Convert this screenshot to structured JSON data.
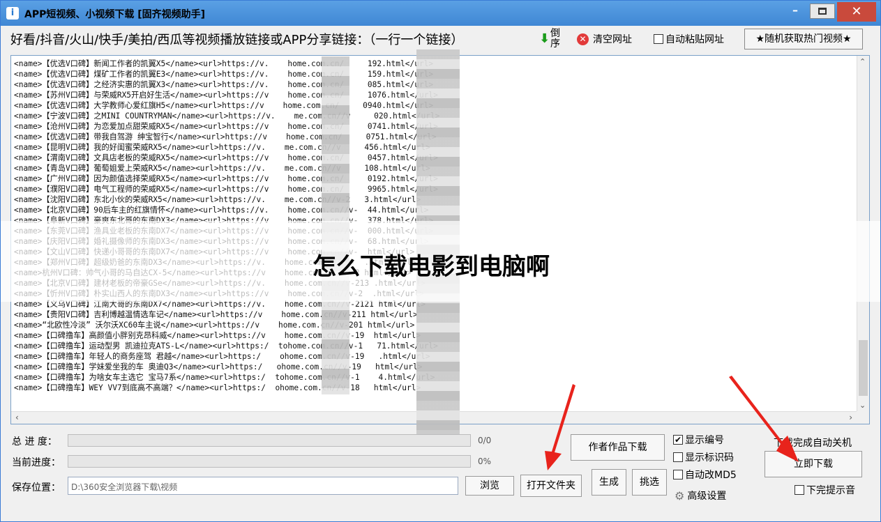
{
  "window": {
    "title": "APP短视频、小视频下载 [固齐视频助手]",
    "minimize_glyph": "–",
    "close_glyph": "✕"
  },
  "toolbar": {
    "instruction": "好看/抖音/火山/快手/美拍/西瓜等视频播放链接或APP分享链接：（一行一个链接）",
    "sort_arrow": "⬇",
    "sort_label": "倒序",
    "clear_icon_glyph": "✕",
    "clear_label": "清空网址",
    "auto_paste_label": "自动粘贴网址",
    "auto_paste_checked": false,
    "random_hot_label": "★随机获取热门视频★"
  },
  "links": [
    "<name>【优选V口碑】新闻工作者的凯翼X5</name><url>https://v.    home.com.cn/     192.html</url>",
    "<name>【优选V口碑】煤矿工作者的凯翼E3</name><url>https://v.    home.com.cn/     159.html</url>",
    "<name>【优选V口碑】之经济实惠的凯翼X3</name><url>https://v.    home.com.cn/     085.html</url>",
    "<name>【苏州V口碑】与荣威RX5开启好生活</name><url>https://v    home.com.cn/     1076.html</url>",
    "<name>【优选V口碑】大学教师心爱红旗H5</name><url>https://v    home.com.cn/     0940.html</url>",
    "<name>【宁波V口碑】之MINI COUNTRYMAN</name><url>https://v.    me.com.cn//v     020.html</url>",
    "<name>【沧州V口碑】为恋爱加点甜荣威RX5</name><url>https://v    home.com.cn/     0741.html</url>",
    "<name>【优选V口碑】带我自驾游 绅宝智行</name><url>https://v    home.com.cn/     0751.html</url>",
    "<name>【昆明V口碑】我的好闺蜜荣威RX5</name><url>https://v.    me.com.cn//v     456.html</url>",
    "<name>【渭南V口碑】文具店老板的荣威RX5</name><url>https://v    home.com.cn/     0457.html</url>",
    "<name>【青岛V口碑】葡萄姐爱上荣威RX5</name><url>https://v.    me.com.cn//v     108.html</url>",
    "<name>【广州V口碑】因为颜值选择荣威RX5</name><url>https://v    home.com.cn/     0192.html</url>",
    "<name>【濮阳V口碑】电气工程师的荣威RX5</name><url>https://v    home.com.cn/     9965.html</url>",
    "<name>【沈阳V口碑】东北小伙的荣威RX5</name><url>https://v.    me.com.cn//v-2   3.html</url>",
    "<name>【北京V口碑】90后车主的红旗情怀</name><url>https://v.    home.com.cn//v-  44.html</url>",
    "<name>【阜新V口碑】豪爽东北哥的东南DX3</name><url>https://v    home.com.cn//v-  378.html</url>",
    "<name>【东莞V口碑】渔具业老板的东南DX7</name><url>https://v    home.com.cn//v-  000.html</url>",
    "<name>【庆阳V口碑】婚礼摄像师的东南DX3</name><url>https://v    home.com.cn//v-  68.html</url>",
    "<name>【文山V口碑】快递小哥哥的东南DX7</name><url>https://v    home.com.cn//v-  html</url>",
    "<name>【郑州V口碑】超级奶爸的东南DX3</name><url>https://v.    home.com.cn//v-  .html</url>",
    "<name>杭州V口碑：帅气小哥的马自达CX-5</name><url>https://v    home.com.cn//v-2 html</url>",
    "<name>【北京V口碑】建材老板的帝豪GSe</name><url>https://v.    home.com.cn//v-213 .html</url>",
    "<name>【忻州V口碑】朴实山西人的东南DX3</name><url>https://v    home.com.cn//v-2  .html</url>",
    "<name>【义乌V口碑】江南大哥的东南DX7</name><url>https://v.    home.com.cn//v-2121 html</url>",
    "<name>【贵阳V口碑】吉利博越温情选车记</name><url>https://v    home.com.cn//v-211 html</url>",
    "<name>“北欧性冷淡” 沃尔沃XC60车主说</name><url>https://v    home.com.cn//v-201 html</url>",
    "<name>【口碑撸车】高颜值小胖别克昂科威</name><url>https://v    home.com.cn//v-19  html</url>",
    "<name>【口碑撸车】运动型男 凯迪拉克ATS-L</name><url>https:/  tohome.com.cn//v-1   71.html</url>",
    "<name>【口碑撸车】年轻人的商务座驾 君越</name><url>https:/    ohome.com.cn//v-19   .html</url>",
    "<name>【口碑撸车】学妹爱坐我的车 奥迪Q3</name><url>https:/   ohome.com.cn//v-19   html</url>",
    "<name>【口碑撸车】为啥女车主选它 宝马7系</name><url>https:/  tohome.com.cn//v-1    4.html</url>",
    "<name>【口碑撸车】WEY VV7到底高不高端？</name><url>https:/  ohome.com.cn//v-18   html</url>"
  ],
  "scroll": {
    "up_glyph": "⌃",
    "down_glyph": "⌄",
    "left_glyph": "‹",
    "right_glyph": "›"
  },
  "overlay": {
    "headline": "怎么下载电影到电脑啊"
  },
  "progress": {
    "total_label": "总 进 度：",
    "total_text": "0/0",
    "total_fraction": 0,
    "current_label": "当前进度：",
    "current_text": "0%",
    "current_fraction": 0
  },
  "save": {
    "label": "保存位置：",
    "path": "D:\\360安全浏览器下载\\视频"
  },
  "buttons": {
    "browse": "浏览",
    "open_folder": "打开文件夹",
    "author_download": "作者作品下载",
    "generate": "生成",
    "pick": "挑选",
    "download_now": "立即下载"
  },
  "options": {
    "show_number": {
      "label": "显示编号",
      "checked": true
    },
    "show_id": {
      "label": "显示标识码",
      "checked": false
    },
    "auto_md5": {
      "label": "自动改MD5",
      "checked": false
    },
    "advanced": "高级设置",
    "auto_shutdown": {
      "label": "下载完成自动关机",
      "checked": false
    },
    "done_sound": {
      "label": "下完提示音",
      "checked": false
    }
  },
  "colors": {
    "titlebar": "#3f87d4",
    "progress_fill": "#06b025",
    "annotation_arrow": "#e8231c"
  }
}
